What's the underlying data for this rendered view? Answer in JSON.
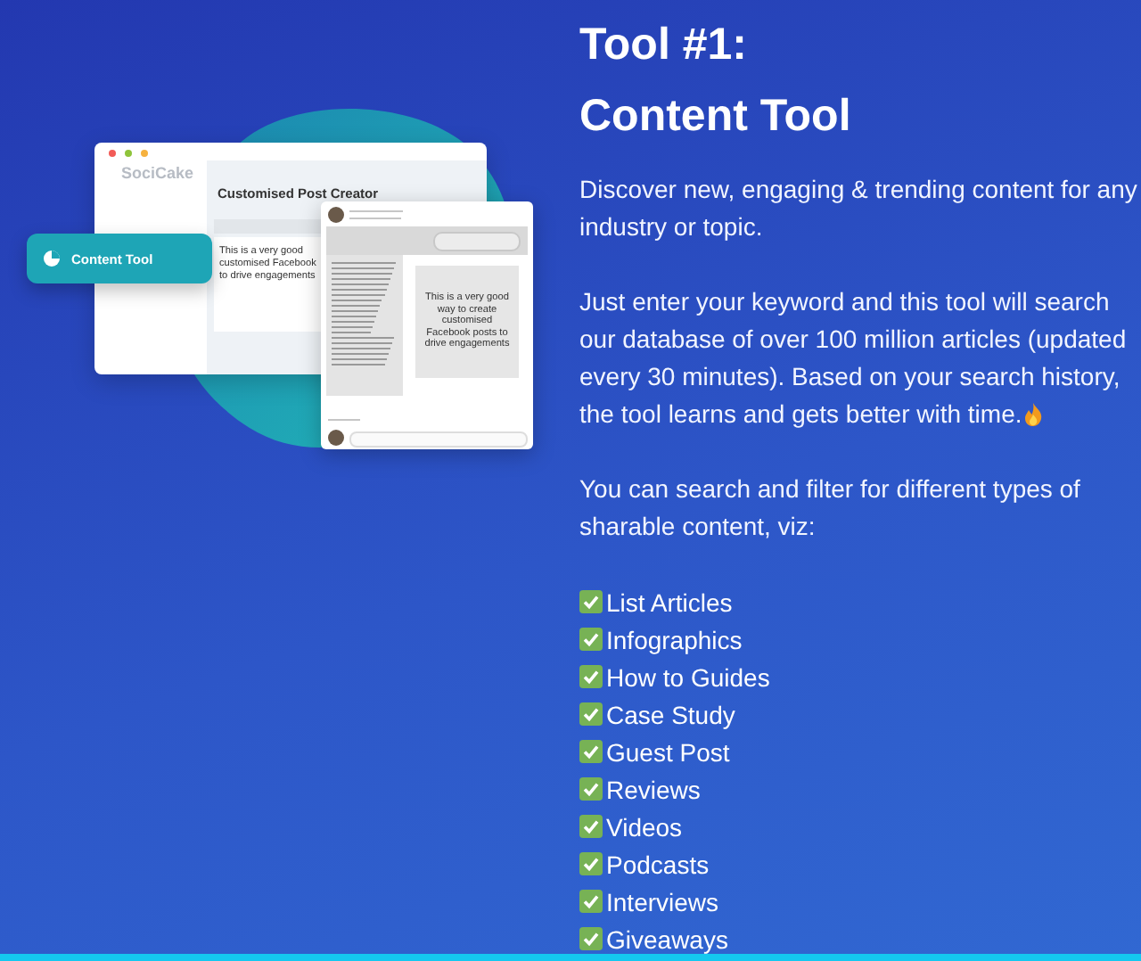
{
  "illustration": {
    "badge": "Content Tool",
    "app_window": {
      "brand": "SociCake",
      "heading": "Customised Post Creator",
      "editor_lines": [
        "This is a very good",
        "customised Facebook",
        "to drive engagements"
      ]
    },
    "post_card": {
      "post_text": "This is a very good way to create customised Facebook posts to drive engagements"
    }
  },
  "info": {
    "title_lines": [
      "Tool #1:",
      "Content Tool"
    ],
    "paragraphs": [
      "Discover new, engaging & trending content for any industry or topic.",
      "Just enter your keyword and this tool will search our database of over 100 million articles (updated every 30 minutes). Based on your search history, the tool learns and gets better with time.",
      "You can search and filter for different types of sharable content, viz:"
    ],
    "list": [
      {
        "label": "List Articles",
        "checked": true
      },
      {
        "label": "Infographics",
        "checked": true
      },
      {
        "label": "How to Guides",
        "checked": true
      },
      {
        "label": "Case Study",
        "checked": true
      },
      {
        "label": "Guest Post",
        "checked": true
      },
      {
        "label": "Reviews",
        "checked": true
      },
      {
        "label": "Videos",
        "checked": true
      },
      {
        "label": "Podcasts",
        "checked": true
      },
      {
        "label": "Interviews",
        "checked": true
      },
      {
        "label": "Giveaways",
        "checked": true
      }
    ]
  }
}
